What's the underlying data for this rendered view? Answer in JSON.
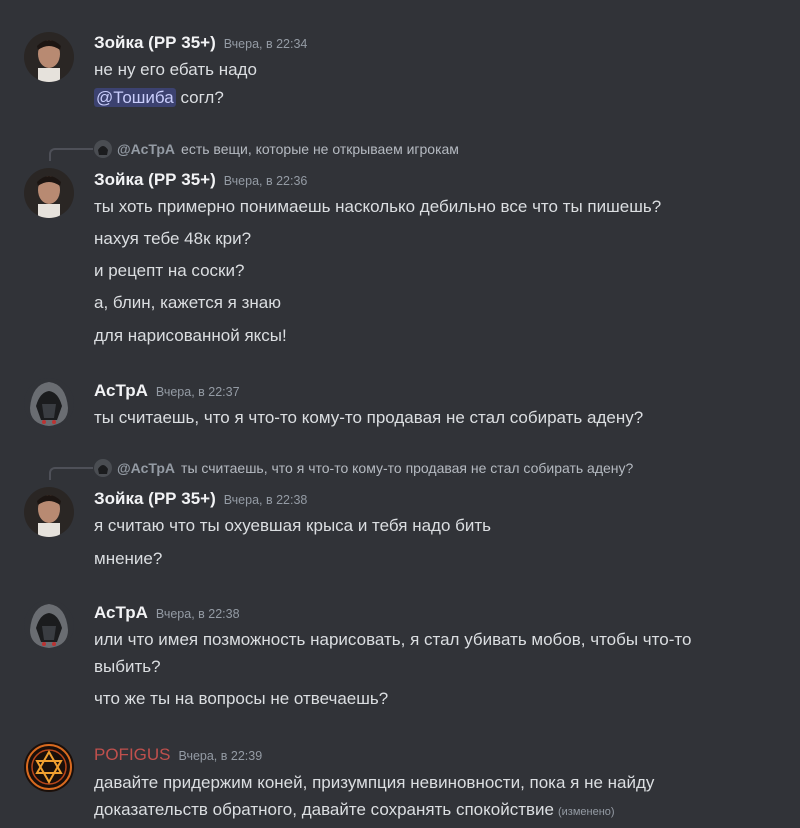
{
  "messages": [
    {
      "author": "Зойка (РР 35+)",
      "timestamp": "Вчера, в 22:34",
      "lines": [
        "не ну его ебать надо",
        "согл?"
      ],
      "mention": "@Тошиба"
    },
    {
      "reply": {
        "author": "@АсТрА",
        "text": "есть вещи, которые не открываем игрокам"
      },
      "author": "Зойка (РР 35+)",
      "timestamp": "Вчера, в 22:36",
      "lines": [
        "ты хоть примерно понимаешь насколько дебильно все что ты пишешь?",
        "нахуя тебе 48к кри?",
        "и рецепт на соски?",
        "а, блин, кажется я знаю",
        "для нарисованной яксы!"
      ]
    },
    {
      "author": "АсТрА",
      "timestamp": "Вчера, в 22:37",
      "lines": [
        "ты считаешь, что я что-то кому-то продавая не стал собирать адену?"
      ]
    },
    {
      "reply": {
        "author": "@АсТрА",
        "text": "ты считаешь, что я что-то кому-то продавая не стал собирать адену?"
      },
      "author": "Зойка (РР 35+)",
      "timestamp": "Вчера, в 22:38",
      "lines": [
        "я считаю что ты охуевшая крыса и тебя надо бить",
        "мнение?"
      ]
    },
    {
      "author": "АсТрА",
      "timestamp": "Вчера, в 22:38",
      "lines": [
        "или что  имея позможность нарисовать, я стал убивать мобов, чтобы что-то",
        "выбить?",
        "что же ты на вопросы не отвечаешь?"
      ]
    },
    {
      "author": "POFIGUS",
      "author_color": "#c0504d",
      "timestamp": "Вчера, в 22:39",
      "lines": [
        "давайте придержим коней, призумпция невиновности, пока я не найду",
        "доказательств обратного, давайте сохранять спокойствие"
      ],
      "edited": "(изменено)"
    }
  ]
}
